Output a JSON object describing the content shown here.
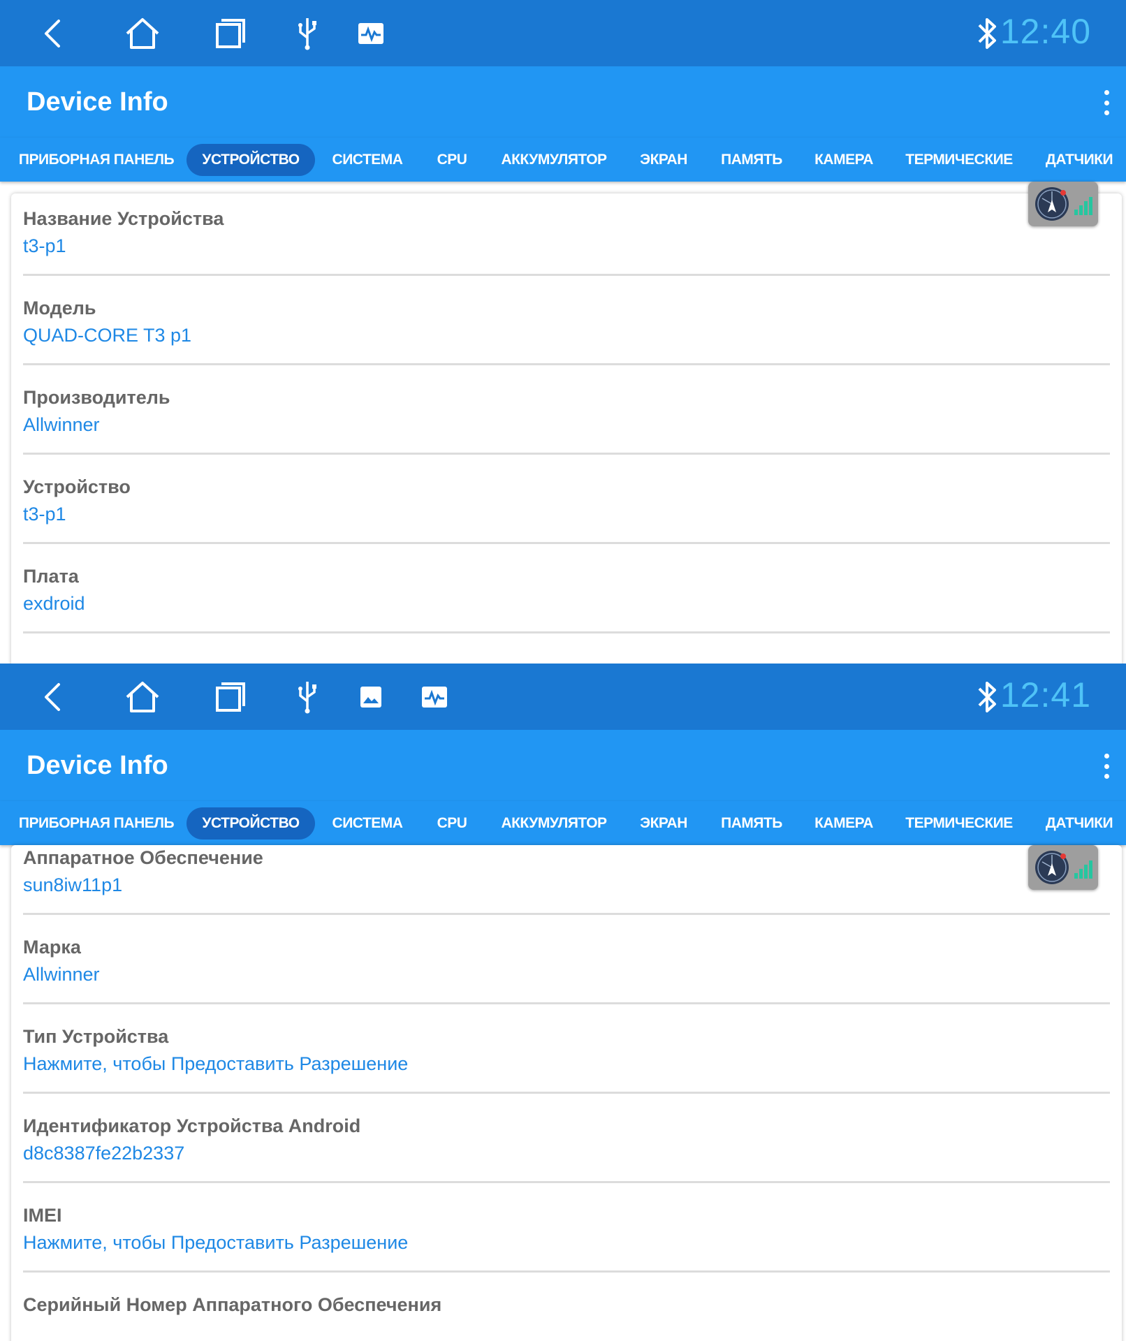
{
  "screens": [
    {
      "status": {
        "time": "12:40",
        "icons": [
          "back-icon",
          "home-icon",
          "recents-icon",
          "usb-icon",
          "activity-icon"
        ],
        "bluetooth": "bluetooth-icon"
      },
      "appbar": {
        "title": "Device Info"
      },
      "tabs": [
        "ПРИБОРНАЯ ПАНЕЛЬ",
        "УСТРОЙСТВО",
        "СИСТЕМА",
        "CPU",
        "АККУМУЛЯТОР",
        "ЭКРАН",
        "ПАМЯТЬ",
        "КАМЕРА",
        "ТЕРМИЧЕСКИЕ",
        "ДАТЧИКИ"
      ],
      "active_tab": "УСТРОЙСТВО",
      "rows": [
        {
          "label": "Название Устройства",
          "value": "t3-p1"
        },
        {
          "label": "Модель",
          "value": "QUAD-CORE T3 p1"
        },
        {
          "label": "Производитель",
          "value": "Allwinner"
        },
        {
          "label": "Устройство",
          "value": "t3-p1"
        },
        {
          "label": "Плата",
          "value": "exdroid"
        }
      ]
    },
    {
      "status": {
        "time": "12:41",
        "icons": [
          "back-icon",
          "home-icon",
          "recents-icon",
          "usb-icon",
          "image-icon",
          "activity-icon"
        ],
        "bluetooth": "bluetooth-icon"
      },
      "appbar": {
        "title": "Device Info"
      },
      "tabs": [
        "ПРИБОРНАЯ ПАНЕЛЬ",
        "УСТРОЙСТВО",
        "СИСТЕМА",
        "CPU",
        "АККУМУЛЯТОР",
        "ЭКРАН",
        "ПАМЯТЬ",
        "КАМЕРА",
        "ТЕРМИЧЕСКИЕ",
        "ДАТЧИКИ"
      ],
      "active_tab": "УСТРОЙСТВО",
      "rows": [
        {
          "label": "Аппаратное Обеспечение",
          "value": "sun8iw11p1"
        },
        {
          "label": "Марка",
          "value": "Allwinner"
        },
        {
          "label": "Тип Устройства",
          "value": "Нажмите, чтобы Предоставить Разрешение"
        },
        {
          "label": "Идентификатор Устройства Android",
          "value": "d8c8387fe22b2337"
        },
        {
          "label": "IMEI",
          "value": "Нажмите, чтобы Предоставить Разрешение"
        },
        {
          "label": "Серийный Номер Аппаратного Обеспечения",
          "value": ""
        }
      ]
    }
  ],
  "colors": {
    "status_bar": "#1a78d2",
    "app_bar": "#2196f3",
    "active_tab": "#1565c0",
    "clock": "#4fc3f7",
    "value_text": "#1e88e5",
    "label_text": "#666666"
  }
}
